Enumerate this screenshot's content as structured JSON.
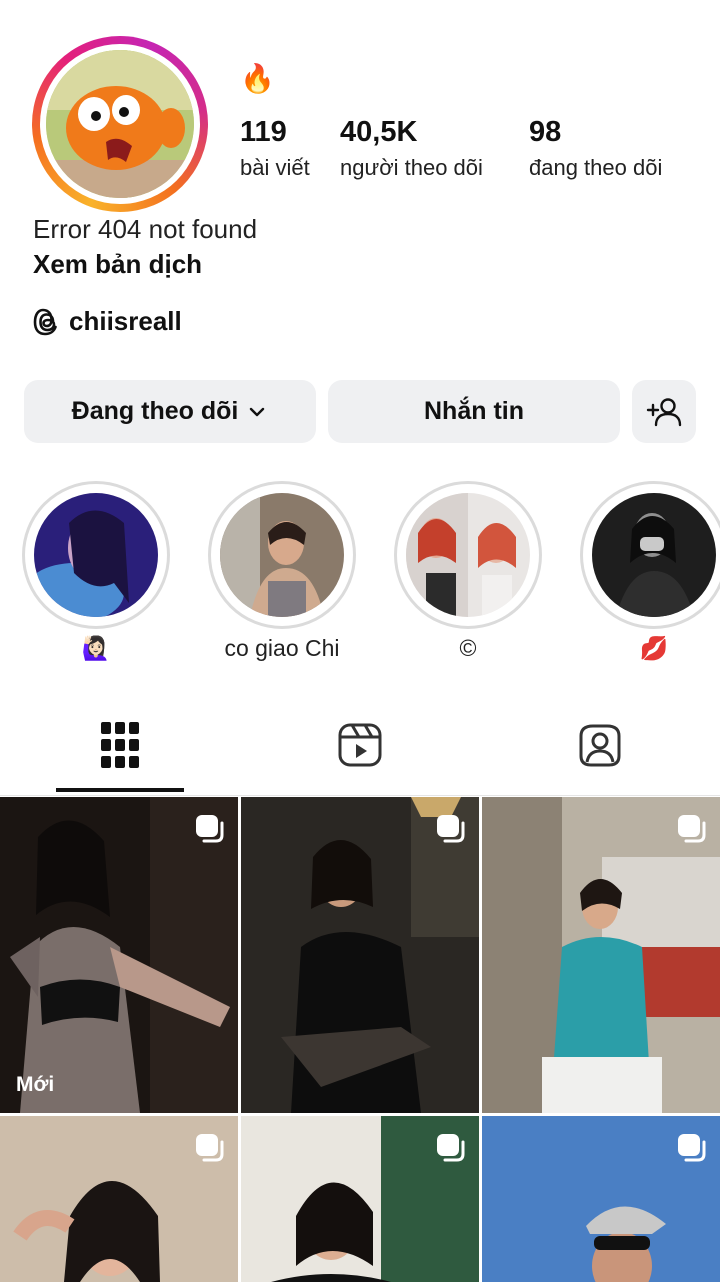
{
  "profile": {
    "note_emoji": "🔥",
    "stats": [
      {
        "count": "119",
        "label": "bài viết"
      },
      {
        "count": "40,5K",
        "label": "người theo dõi"
      },
      {
        "count": "98",
        "label": "đang theo dõi"
      }
    ],
    "bio": "Error 404 not found",
    "translate_link": "Xem bản dịch",
    "threads_handle": "chiisreall"
  },
  "actions": {
    "following_label": "Đang theo dõi",
    "message_label": "Nhắn tin"
  },
  "highlights": [
    {
      "label": "🙋🏻‍♀️"
    },
    {
      "label": "co giao Chi"
    },
    {
      "label": "©"
    },
    {
      "label": "💋"
    }
  ],
  "tabs": [
    "posts-grid",
    "reels",
    "tagged"
  ],
  "posts": [
    {
      "badge": "Mới"
    }
  ]
}
